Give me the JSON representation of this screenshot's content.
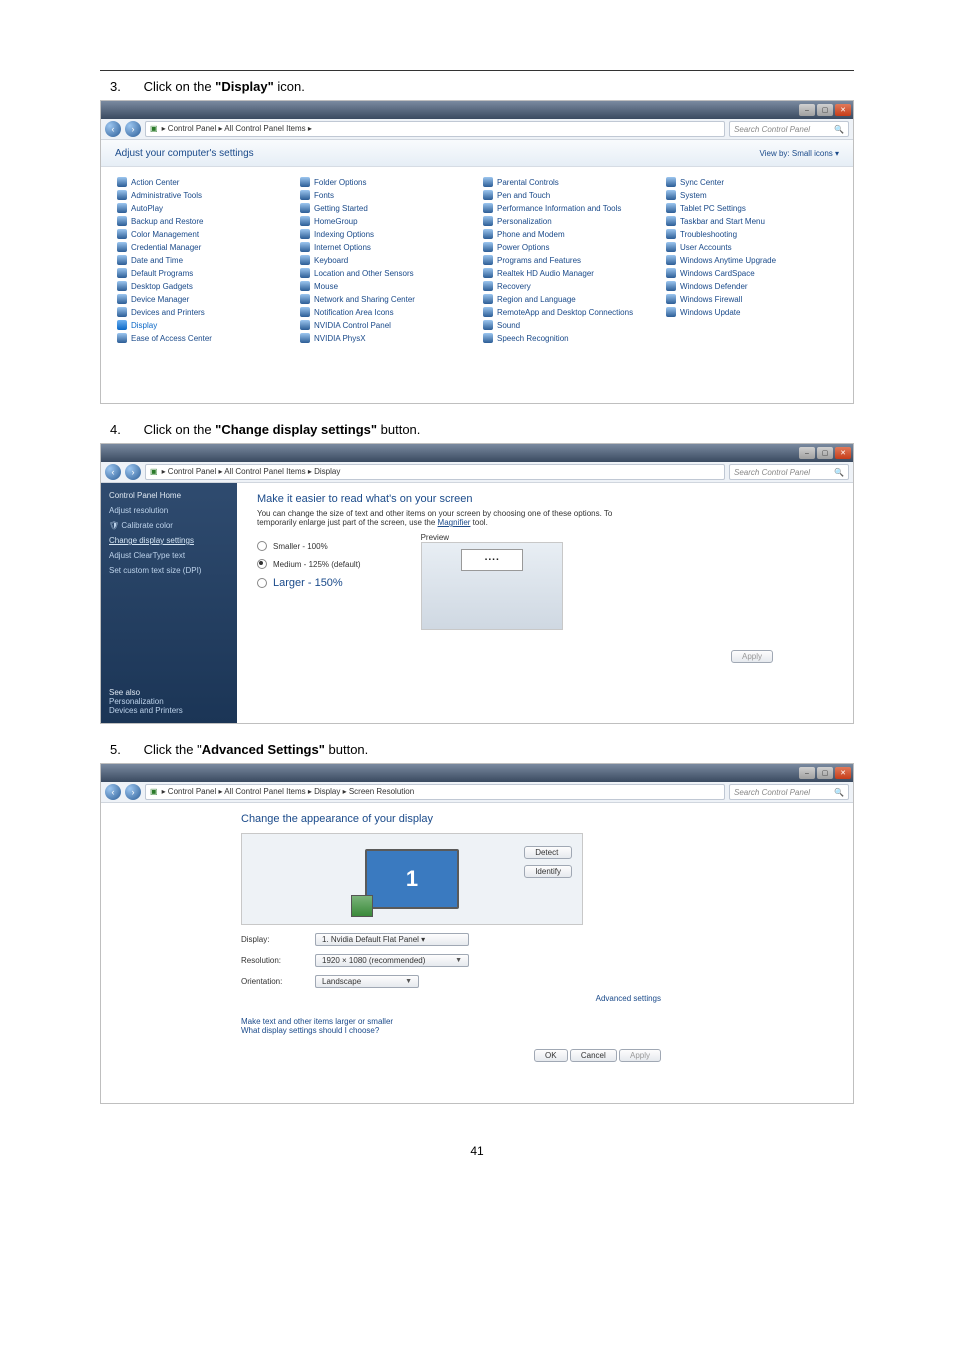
{
  "page_number": "41",
  "steps": {
    "s3": {
      "num": "3.",
      "pre": "Click on the ",
      "bold": "\"Display\"",
      "post": " icon."
    },
    "s4": {
      "num": "4.",
      "pre": "Click on the ",
      "bold": "\"Change display settings\"",
      "post": " button."
    },
    "s5": {
      "num": "5.",
      "pre": "Click the \"",
      "bold": "Advanced Settings\"",
      "post": " button."
    }
  },
  "win_common": {
    "back": "‹",
    "fwd": "›",
    "min": "–",
    "max": "▢",
    "close": "✕",
    "search_placeholder": "Search Control Panel",
    "magnifier": "🔍"
  },
  "shot1": {
    "breadcrumb": "▸ Control Panel ▸ All Control Panel Items ▸",
    "header_title": "Adjust your computer's settings",
    "viewby_label": "View by:",
    "viewby_value": "Small icons ▾",
    "items": [
      "Action Center",
      "Administrative Tools",
      "AutoPlay",
      "Backup and Restore",
      "Color Management",
      "Credential Manager",
      "Date and Time",
      "Default Programs",
      "Desktop Gadgets",
      "Device Manager",
      "Devices and Printers",
      "Display",
      "Ease of Access Center",
      "Folder Options",
      "Fonts",
      "Getting Started",
      "HomeGroup",
      "Indexing Options",
      "Internet Options",
      "Keyboard",
      "Location and Other Sensors",
      "Mouse",
      "Network and Sharing Center",
      "Notification Area Icons",
      "NVIDIA Control Panel",
      "NVIDIA PhysX",
      "Parental Controls",
      "Pen and Touch",
      "Performance Information and Tools",
      "Personalization",
      "Phone and Modem",
      "Power Options",
      "Programs and Features",
      "Realtek HD Audio Manager",
      "Recovery",
      "Region and Language",
      "RemoteApp and Desktop Connections",
      "Sound",
      "Speech Recognition",
      "Sync Center",
      "System",
      "Tablet PC Settings",
      "Taskbar and Start Menu",
      "Troubleshooting",
      "User Accounts",
      "Windows Anytime Upgrade",
      "Windows CardSpace",
      "Windows Defender",
      "Windows Firewall",
      "Windows Update"
    ],
    "highlight_index": 11
  },
  "shot2": {
    "breadcrumb": "▸ Control Panel ▸ All Control Panel Items ▸ Display",
    "side": {
      "home": "Control Panel Home",
      "adjust_res": "Adjust resolution",
      "calibrate": "Calibrate color",
      "change_disp": "Change display settings",
      "cleartype": "Adjust ClearType text",
      "dpi": "Set custom text size (DPI)",
      "see_also": "See also",
      "personalization": "Personalization",
      "devices": "Devices and Printers"
    },
    "main": {
      "title": "Make it easier to read what's on your screen",
      "desc_pre": "You can change the size of text and other items on your screen by choosing one of these options. To temporarily enlarge just part of the screen, use the ",
      "desc_link": "Magnifier",
      "desc_post": " tool.",
      "opt_small": "Smaller - 100%",
      "opt_medium": "Medium - 125% (default)",
      "opt_large": "Larger - 150%",
      "preview_label": "Preview",
      "preview_window_text": "▪ ▪ ▪ ▪",
      "apply": "Apply"
    }
  },
  "shot3": {
    "breadcrumb": "▸ Control Panel ▸ All Control Panel Items ▸ Display ▸ Screen Resolution",
    "title": "Change the appearance of your display",
    "monitor_number": "1",
    "detect": "Detect",
    "identify": "Identify",
    "display_label": "Display:",
    "display_value": "1. Nvidia Default Flat Panel ▾",
    "resolution_label": "Resolution:",
    "resolution_value": "1920 × 1080 (recommended)",
    "orientation_label": "Orientation:",
    "orientation_value": "Landscape",
    "advanced": "Advanced settings",
    "link1": "Make text and other items larger or smaller",
    "link2": "What display settings should I choose?",
    "ok": "OK",
    "cancel": "Cancel",
    "apply": "Apply"
  }
}
